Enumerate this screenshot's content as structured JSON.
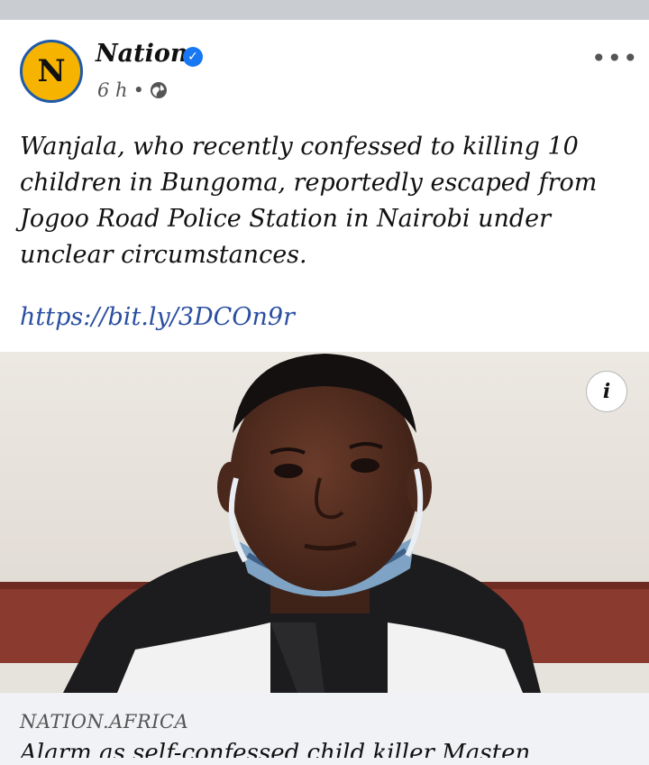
{
  "page": {
    "name": "Nation",
    "avatar_letter": "N",
    "time": "6 h",
    "dot": "•",
    "more_icon": "more-dots-icon"
  },
  "post": {
    "text": "Wanjala, who recently confessed to killing 10 children in Bungoma, reportedly escaped from Jogoo Road Police Station in Nairobi under unclear circumstances.",
    "link": "https://bit.ly/3DCOn9r"
  },
  "preview": {
    "info_label": "i",
    "domain": "NATION.AFRICA",
    "headline": "Alarm as self-confessed child killer Masten"
  },
  "colors": {
    "accent_link": "#2a4ea0",
    "verified": "#1877f2",
    "avatar_bg": "#f6b400",
    "avatar_ring": "#1e5aa8"
  }
}
